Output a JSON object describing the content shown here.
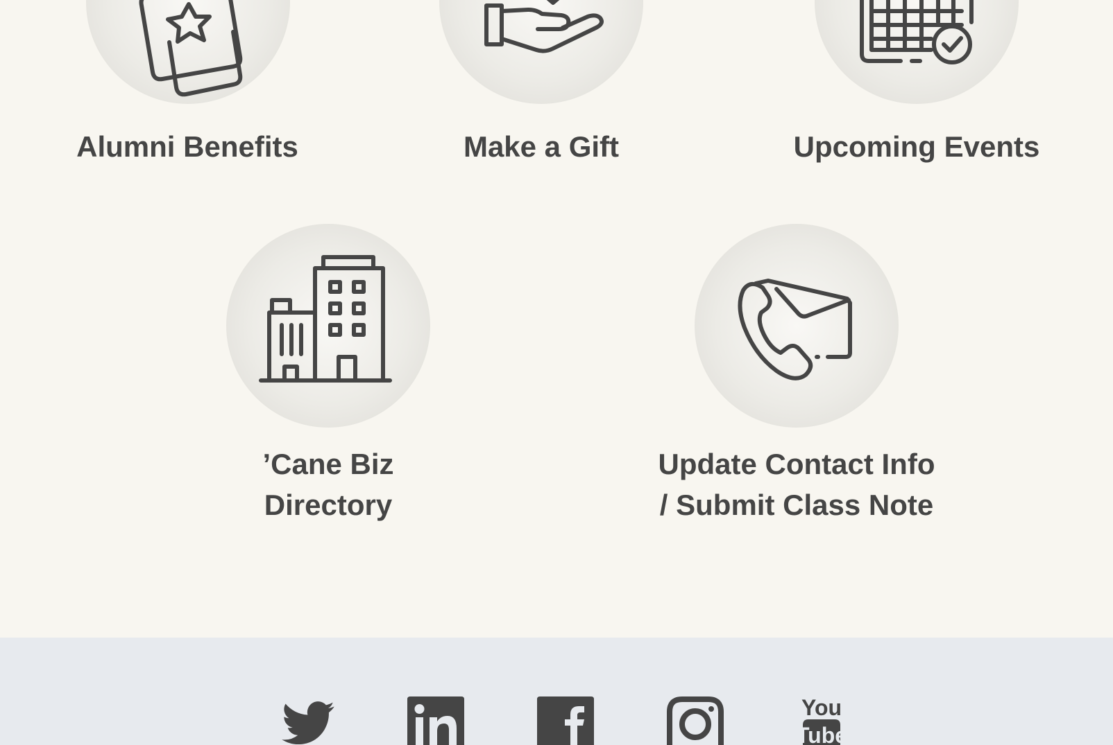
{
  "links": {
    "alumni_benefits": "Alumni Benefits",
    "make_a_gift": "Make a Gift",
    "upcoming_events": "Upcoming Events",
    "cane_biz_line1": "’Cane Biz",
    "cane_biz_line2": "Directory",
    "update_contact_line1": "Update Contact Info",
    "update_contact_line2": "/ Submit Class Note"
  },
  "icons": {
    "alumni_benefits": "card-star-icon",
    "make_a_gift": "hand-gift-icon",
    "upcoming_events": "calendar-check-icon",
    "cane_biz": "buildings-icon",
    "update_contact": "phone-envelope-icon"
  },
  "social": {
    "twitter": "twitter-icon",
    "linkedin": "linkedin-icon",
    "facebook": "facebook-icon",
    "instagram": "instagram-icon",
    "youtube": "youtube-icon",
    "youtube_top": "You",
    "youtube_bottom": "Tube"
  },
  "colors": {
    "text": "#454545",
    "icon": "#454545",
    "main_bg": "#f8f6f0",
    "footer_bg": "#e7eaee"
  }
}
